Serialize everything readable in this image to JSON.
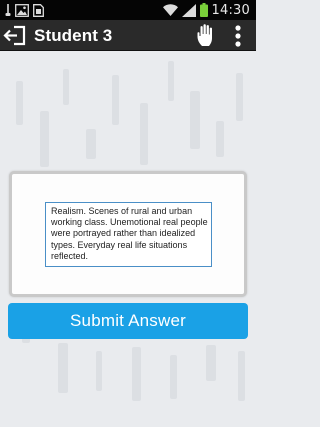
{
  "status_bar": {
    "time": "14:30",
    "icons": [
      "usb-icon",
      "image-notification-icon",
      "sim-card-icon",
      "wifi-icon",
      "signal-icon",
      "battery-icon"
    ]
  },
  "app_bar": {
    "title": "Student 3",
    "back_icon": "back-arrow-icon",
    "raise_hand_icon": "raise-hand-icon",
    "overflow_icon": "overflow-menu-icon"
  },
  "answer": {
    "text": "Realism. Scenes of rural and urban working class. Unemotional real people were portrayed rather than idealized types. Everyday real life situations reflected."
  },
  "submit": {
    "label": "Submit Answer"
  },
  "colors": {
    "status_bar": "#050505",
    "app_bar": "#2a2a2a",
    "background": "#e9ebee",
    "accent": "#1aa1e6",
    "field_border": "#4a8fc7",
    "battery": "#7ad03a"
  }
}
